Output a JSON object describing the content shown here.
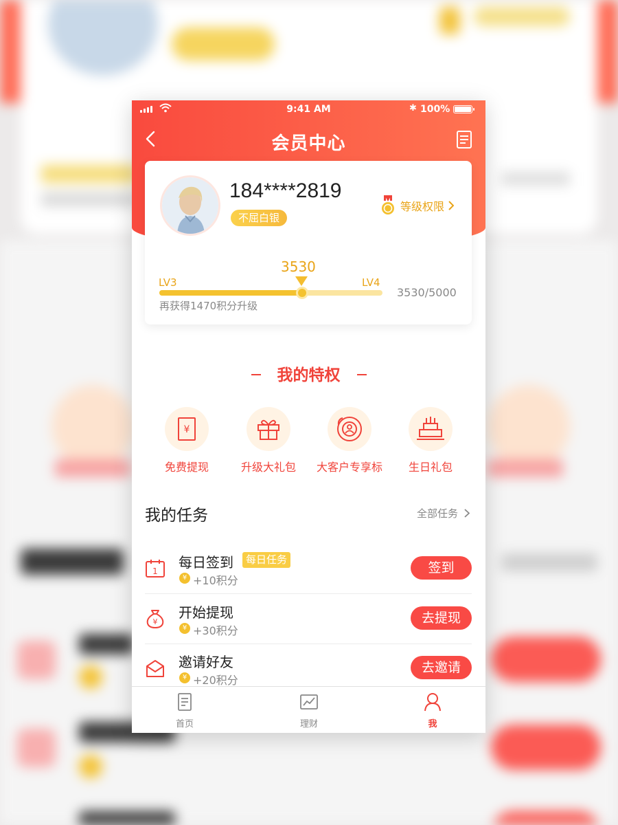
{
  "status_bar": {
    "time": "9:41 AM",
    "battery": "100%"
  },
  "nav": {
    "title": "会员中心",
    "back_icon": "chevron-left-icon",
    "doc_icon": "document-icon"
  },
  "member": {
    "phone": "184****2819",
    "tier": "不屈白银",
    "privilege_link": "等级权限",
    "level_current": "LV3",
    "level_next": "LV4",
    "points_current": "3530",
    "points_display": "3530/5000",
    "progress": 0.64,
    "upgrade_hint": "再获得1470积分升级"
  },
  "privileges": {
    "title": "我的特权",
    "items": [
      {
        "label": "免费提现",
        "icon": "cash-withdraw-icon"
      },
      {
        "label": "升级大礼包",
        "icon": "gift-icon"
      },
      {
        "label": "大客户专享标",
        "icon": "vip-badge-icon"
      },
      {
        "label": "生日礼包",
        "icon": "birthday-cake-icon"
      }
    ]
  },
  "tasks": {
    "title": "我的任务",
    "all_link": "全部任务",
    "items": [
      {
        "name": "每日签到",
        "tag": "每日任务",
        "points": "+10积分",
        "button": "签到",
        "icon": "calendar-icon"
      },
      {
        "name": "开始提现",
        "tag": "",
        "points": "+30积分",
        "button": "去提现",
        "icon": "money-bag-icon"
      },
      {
        "name": "邀请好友",
        "tag": "",
        "points": "+20积分",
        "button": "去邀请",
        "icon": "envelope-icon"
      }
    ]
  },
  "tabbar": {
    "items": [
      {
        "label": "首页",
        "icon": "home-doc-icon",
        "active": false
      },
      {
        "label": "理财",
        "icon": "chart-icon",
        "active": false
      },
      {
        "label": "我",
        "icon": "user-icon",
        "active": true
      }
    ]
  },
  "colors": {
    "brand_red": "#f94a3e",
    "gold": "#f4c22f",
    "text_dark": "#222222",
    "text_gray": "#888888"
  }
}
